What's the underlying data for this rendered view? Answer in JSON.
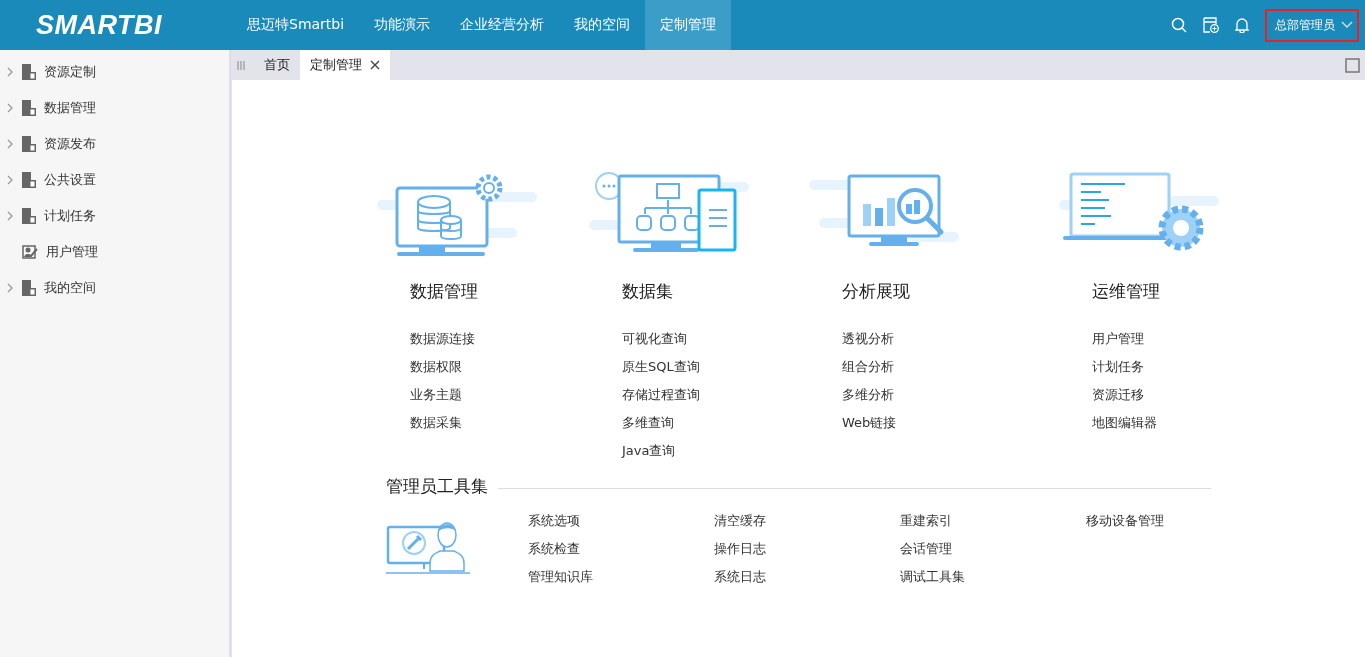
{
  "header": {
    "logo": "SMARTBI",
    "nav": [
      {
        "label": "思迈特Smartbi",
        "selected": false
      },
      {
        "label": "功能演示",
        "selected": false
      },
      {
        "label": "企业经营分析",
        "selected": false
      },
      {
        "label": "我的空间",
        "selected": false
      },
      {
        "label": "定制管理",
        "selected": true
      }
    ],
    "user": "总部管理员"
  },
  "sidebar": {
    "items": [
      {
        "label": "资源定制",
        "expandable": true
      },
      {
        "label": "数据管理",
        "expandable": true
      },
      {
        "label": "资源发布",
        "expandable": true
      },
      {
        "label": "公共设置",
        "expandable": true
      },
      {
        "label": "计划任务",
        "expandable": true
      },
      {
        "label": "用户管理",
        "expandable": false
      },
      {
        "label": "我的空间",
        "expandable": true
      }
    ]
  },
  "tabs": [
    {
      "label": "首页",
      "selected": false,
      "closable": false
    },
    {
      "label": "定制管理",
      "selected": true,
      "closable": true
    }
  ],
  "categories": [
    {
      "kind": "database",
      "title": "数据管理",
      "links": [
        "数据源连接",
        "数据权限",
        "业务主题",
        "数据采集"
      ]
    },
    {
      "kind": "dataset",
      "title": "数据集",
      "links": [
        "可视化查询",
        "原生SQL查询",
        "存储过程查询",
        "多维查询",
        "Java查询"
      ]
    },
    {
      "kind": "analysis",
      "title": "分析展现",
      "links": [
        "透视分析",
        "组合分析",
        "多维分析",
        "Web链接"
      ]
    },
    {
      "kind": "operations",
      "title": "运维管理",
      "links": [
        "用户管理",
        "计划任务",
        "资源迁移",
        "地图编辑器"
      ]
    }
  ],
  "admin_tools": {
    "title": "管理员工具集",
    "links": [
      "系统选项",
      "系统检查",
      "管理知识库",
      "清空缓存",
      "操作日志",
      "系统日志",
      "重建索引",
      "会话管理",
      "调试工具集",
      "移动设备管理"
    ]
  }
}
